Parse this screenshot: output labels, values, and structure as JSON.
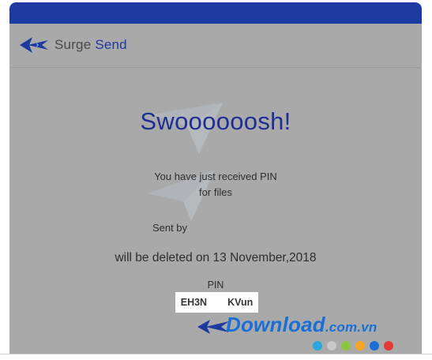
{
  "colors": {
    "top_bar": "#1d3aa0",
    "card_bg": "#a9a9a9",
    "headline": "#1e2f94",
    "logo_primary": "#1d3a9e"
  },
  "brand": {
    "word1": "Surge",
    "word2": "Send",
    "icon": "surge-send-logo-icon"
  },
  "email": {
    "headline": "Swoooooosh!",
    "received_text": "You have just received PIN",
    "files_text": "for files",
    "sent_by_label": "Sent by",
    "deleted_text": "will be deleted on 13 November,2018",
    "pin_label": "PIN",
    "pin_start": "EH3N",
    "pin_end": "KVun"
  },
  "watermark": {
    "site": "Download",
    "domain": ".com.vn",
    "dot_colors": [
      "#2aa8e0",
      "#c8c8c8",
      "#8cc63f",
      "#f5a623",
      "#1a6fd6",
      "#e53935"
    ]
  }
}
